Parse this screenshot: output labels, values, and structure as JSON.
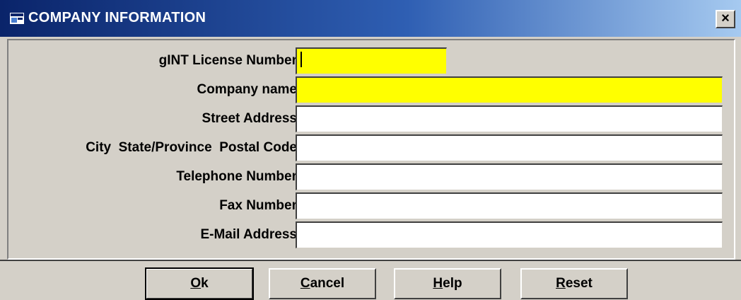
{
  "window": {
    "title": "COMPANY INFORMATION",
    "close_label": "×",
    "icon": "app-window-icon"
  },
  "form": {
    "fields": [
      {
        "label": "gINT License Number",
        "value": "",
        "required": true
      },
      {
        "label": "Company name",
        "value": "",
        "required": true
      },
      {
        "label": "Street Address",
        "value": "",
        "required": false
      },
      {
        "label": "City  State/Province  Postal Code",
        "value": "",
        "required": false
      },
      {
        "label": "Telephone Number",
        "value": "",
        "required": false
      },
      {
        "label": "Fax Number",
        "value": "",
        "required": false
      },
      {
        "label": "E-Mail Address",
        "value": "",
        "required": false
      }
    ]
  },
  "buttons": {
    "ok": {
      "mnemonic": "O",
      "rest": "k"
    },
    "cancel": {
      "mnemonic": "C",
      "rest": "ancel"
    },
    "help": {
      "mnemonic": "H",
      "rest": "elp"
    },
    "reset": {
      "mnemonic": "R",
      "rest": "eset"
    }
  },
  "colors": {
    "required_field": "#ffff00",
    "title_bar": "#0a246a",
    "face": "#d4d0c8"
  }
}
